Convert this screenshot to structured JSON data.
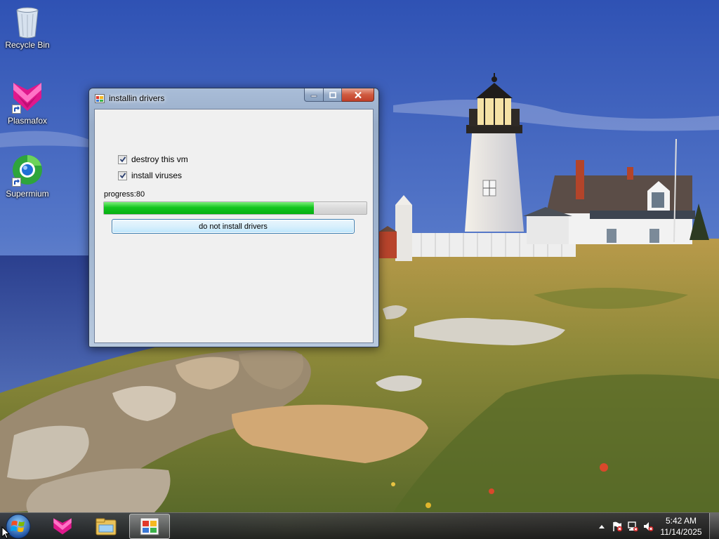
{
  "desktop": {
    "icons": [
      {
        "label": "Recycle Bin",
        "icon": "recycle-bin-icon"
      },
      {
        "label": "Plasmafox",
        "icon": "plasmafox-icon"
      },
      {
        "label": "Supermium",
        "icon": "supermium-icon"
      }
    ]
  },
  "window": {
    "title": "installin drivers",
    "checkboxes": [
      {
        "label": "destroy this vm",
        "checked": true
      },
      {
        "label": "install viruses",
        "checked": true
      }
    ],
    "progress_label": "progress:80",
    "progress_fraction": 0.8,
    "button_label": "do not install drivers"
  },
  "taskbar": {
    "items": [
      "start-orb",
      "plasmafox-taskbar-icon",
      "explorer-taskbar-icon",
      "app-taskbar-icon"
    ],
    "clock_time": "5:42 AM",
    "clock_date": "11/14/2025"
  },
  "colors": {
    "progress_fill": "#06b012",
    "close_button": "#c1402a",
    "sky": "#3a5fb0"
  }
}
